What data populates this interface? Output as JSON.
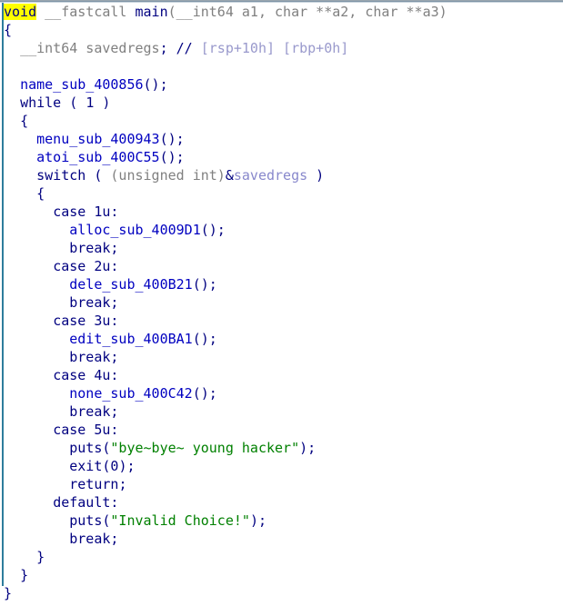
{
  "window": {
    "title": "Pseudocode",
    "kind": "hex-rays-decompiler-pseudocode"
  },
  "colors": {
    "background": "#ffffff",
    "keyword": "#000080",
    "type": "#808080",
    "function": "#0000c0",
    "string": "#008000",
    "comment": "#9999cc",
    "variable": "#8888cc",
    "highlight_bg": "#ffff00",
    "guide_line": "#2e7d9c",
    "gutter": "#fdfdf4"
  },
  "code": {
    "language": "c",
    "highlighted_token": "void",
    "lines": [
      {
        "n": 1,
        "indent": 0,
        "tokens": [
          {
            "t": "void",
            "c": "highlight"
          },
          {
            "t": " ",
            "c": "plain"
          },
          {
            "t": "__fastcall",
            "c": "type"
          },
          {
            "t": " ",
            "c": "plain"
          },
          {
            "t": "main",
            "c": "keyword"
          },
          {
            "t": "(",
            "c": "type"
          },
          {
            "t": "__int64 a1, char **a2, char **a3)",
            "c": "type"
          }
        ]
      },
      {
        "n": 2,
        "indent": 0,
        "tokens": [
          {
            "t": "{",
            "c": "punct"
          }
        ]
      },
      {
        "n": 3,
        "indent": 1,
        "tokens": [
          {
            "t": "__int64 savedregs",
            "c": "type"
          },
          {
            "t": ";",
            "c": "punct"
          },
          {
            "t": " ",
            "c": "plain"
          },
          {
            "t": "//",
            "c": "commentmark"
          },
          {
            "t": " [rsp+10h] [rbp+0h]",
            "c": "comment"
          }
        ]
      },
      {
        "n": 4,
        "indent": 0,
        "tokens": [
          {
            "t": "",
            "c": "plain"
          }
        ]
      },
      {
        "n": 5,
        "indent": 1,
        "tokens": [
          {
            "t": "name_sub_400856",
            "c": "func"
          },
          {
            "t": "();",
            "c": "punct"
          }
        ]
      },
      {
        "n": 6,
        "indent": 1,
        "tokens": [
          {
            "t": "while",
            "c": "keyword"
          },
          {
            "t": " ( ",
            "c": "punct"
          },
          {
            "t": "1",
            "c": "keyword"
          },
          {
            "t": " )",
            "c": "punct"
          }
        ]
      },
      {
        "n": 7,
        "indent": 1,
        "tokens": [
          {
            "t": "{",
            "c": "punct"
          }
        ]
      },
      {
        "n": 8,
        "indent": 2,
        "tokens": [
          {
            "t": "menu_sub_400943",
            "c": "func"
          },
          {
            "t": "();",
            "c": "punct"
          }
        ]
      },
      {
        "n": 9,
        "indent": 2,
        "tokens": [
          {
            "t": "atoi_sub_400C55",
            "c": "func"
          },
          {
            "t": "();",
            "c": "punct"
          }
        ]
      },
      {
        "n": 10,
        "indent": 2,
        "tokens": [
          {
            "t": "switch",
            "c": "keyword"
          },
          {
            "t": " ( ",
            "c": "punct"
          },
          {
            "t": "(unsigned int)",
            "c": "type"
          },
          {
            "t": "&",
            "c": "punct"
          },
          {
            "t": "savedregs",
            "c": "var"
          },
          {
            "t": " )",
            "c": "punct"
          }
        ]
      },
      {
        "n": 11,
        "indent": 2,
        "tokens": [
          {
            "t": "{",
            "c": "punct"
          }
        ]
      },
      {
        "n": 12,
        "indent": 3,
        "tokens": [
          {
            "t": "case",
            "c": "keyword"
          },
          {
            "t": " ",
            "c": "plain"
          },
          {
            "t": "1u",
            "c": "keyword"
          },
          {
            "t": ":",
            "c": "punct"
          }
        ]
      },
      {
        "n": 13,
        "indent": 4,
        "tokens": [
          {
            "t": "alloc_sub_4009D1",
            "c": "func"
          },
          {
            "t": "();",
            "c": "punct"
          }
        ]
      },
      {
        "n": 14,
        "indent": 4,
        "tokens": [
          {
            "t": "break",
            "c": "keyword"
          },
          {
            "t": ";",
            "c": "punct"
          }
        ]
      },
      {
        "n": 15,
        "indent": 3,
        "tokens": [
          {
            "t": "case",
            "c": "keyword"
          },
          {
            "t": " ",
            "c": "plain"
          },
          {
            "t": "2u",
            "c": "keyword"
          },
          {
            "t": ":",
            "c": "punct"
          }
        ]
      },
      {
        "n": 16,
        "indent": 4,
        "tokens": [
          {
            "t": "dele_sub_400B21",
            "c": "func"
          },
          {
            "t": "();",
            "c": "punct"
          }
        ]
      },
      {
        "n": 17,
        "indent": 4,
        "tokens": [
          {
            "t": "break",
            "c": "keyword"
          },
          {
            "t": ";",
            "c": "punct"
          }
        ]
      },
      {
        "n": 18,
        "indent": 3,
        "tokens": [
          {
            "t": "case",
            "c": "keyword"
          },
          {
            "t": " ",
            "c": "plain"
          },
          {
            "t": "3u",
            "c": "keyword"
          },
          {
            "t": ":",
            "c": "punct"
          }
        ]
      },
      {
        "n": 19,
        "indent": 4,
        "tokens": [
          {
            "t": "edit_sub_400BA1",
            "c": "func"
          },
          {
            "t": "();",
            "c": "punct"
          }
        ]
      },
      {
        "n": 20,
        "indent": 4,
        "tokens": [
          {
            "t": "break",
            "c": "keyword"
          },
          {
            "t": ";",
            "c": "punct"
          }
        ]
      },
      {
        "n": 21,
        "indent": 3,
        "tokens": [
          {
            "t": "case",
            "c": "keyword"
          },
          {
            "t": " ",
            "c": "plain"
          },
          {
            "t": "4u",
            "c": "keyword"
          },
          {
            "t": ":",
            "c": "punct"
          }
        ]
      },
      {
        "n": 22,
        "indent": 4,
        "tokens": [
          {
            "t": "none_sub_400C42",
            "c": "func"
          },
          {
            "t": "();",
            "c": "punct"
          }
        ]
      },
      {
        "n": 23,
        "indent": 4,
        "tokens": [
          {
            "t": "break",
            "c": "keyword"
          },
          {
            "t": ";",
            "c": "punct"
          }
        ]
      },
      {
        "n": 24,
        "indent": 3,
        "tokens": [
          {
            "t": "case",
            "c": "keyword"
          },
          {
            "t": " ",
            "c": "plain"
          },
          {
            "t": "5u",
            "c": "keyword"
          },
          {
            "t": ":",
            "c": "punct"
          }
        ]
      },
      {
        "n": 25,
        "indent": 4,
        "tokens": [
          {
            "t": "puts",
            "c": "libfunc"
          },
          {
            "t": "(",
            "c": "punct"
          },
          {
            "t": "\"bye~bye~ young hacker\"",
            "c": "string"
          },
          {
            "t": ");",
            "c": "punct"
          }
        ]
      },
      {
        "n": 26,
        "indent": 4,
        "tokens": [
          {
            "t": "exit",
            "c": "libfunc"
          },
          {
            "t": "(",
            "c": "punct"
          },
          {
            "t": "0",
            "c": "keyword"
          },
          {
            "t": ");",
            "c": "punct"
          }
        ]
      },
      {
        "n": 27,
        "indent": 4,
        "tokens": [
          {
            "t": "return",
            "c": "keyword"
          },
          {
            "t": ";",
            "c": "punct"
          }
        ]
      },
      {
        "n": 28,
        "indent": 3,
        "tokens": [
          {
            "t": "default",
            "c": "keyword"
          },
          {
            "t": ":",
            "c": "punct"
          }
        ]
      },
      {
        "n": 29,
        "indent": 4,
        "tokens": [
          {
            "t": "puts",
            "c": "libfunc"
          },
          {
            "t": "(",
            "c": "punct"
          },
          {
            "t": "\"Invalid Choice!\"",
            "c": "string"
          },
          {
            "t": ");",
            "c": "punct"
          }
        ]
      },
      {
        "n": 30,
        "indent": 4,
        "tokens": [
          {
            "t": "break",
            "c": "keyword"
          },
          {
            "t": ";",
            "c": "punct"
          }
        ]
      },
      {
        "n": 31,
        "indent": 2,
        "tokens": [
          {
            "t": "}",
            "c": "punct"
          }
        ]
      },
      {
        "n": 32,
        "indent": 1,
        "tokens": [
          {
            "t": "}",
            "c": "punct"
          }
        ]
      },
      {
        "n": 33,
        "indent": 0,
        "tokens": [
          {
            "t": "}",
            "c": "punct"
          }
        ]
      }
    ]
  }
}
